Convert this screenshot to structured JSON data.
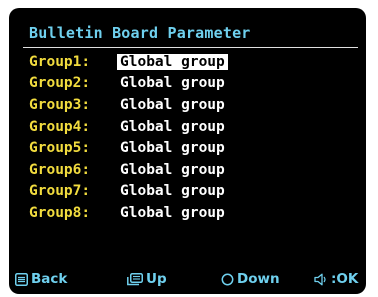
{
  "header": {
    "title": "Bulletin Board Parameter"
  },
  "groups": [
    {
      "label": "Group1:",
      "value": "Global group",
      "selected": true
    },
    {
      "label": "Group2:",
      "value": "Global group",
      "selected": false
    },
    {
      "label": "Group3:",
      "value": "Global group",
      "selected": false
    },
    {
      "label": "Group4:",
      "value": "Global group",
      "selected": false
    },
    {
      "label": "Group5:",
      "value": "Global group",
      "selected": false
    },
    {
      "label": "Group6:",
      "value": "Global group",
      "selected": false
    },
    {
      "label": "Group7:",
      "value": "Global group",
      "selected": false
    },
    {
      "label": "Group8:",
      "value": "Global group",
      "selected": false
    }
  ],
  "footer": {
    "back": {
      "label": "Back",
      "icon": "menu-button-icon"
    },
    "up": {
      "label": "Up",
      "icon": "return-button-icon"
    },
    "down": {
      "label": "Down",
      "icon": "circle-button-icon"
    },
    "ok": {
      "label": ":OK",
      "icon": "volume-button-icon"
    }
  },
  "colors": {
    "background": "#000000",
    "title": "#6fd0ee",
    "label": "#f2dc3e",
    "value": "#ffffff",
    "footer": "#6fd0ee"
  }
}
